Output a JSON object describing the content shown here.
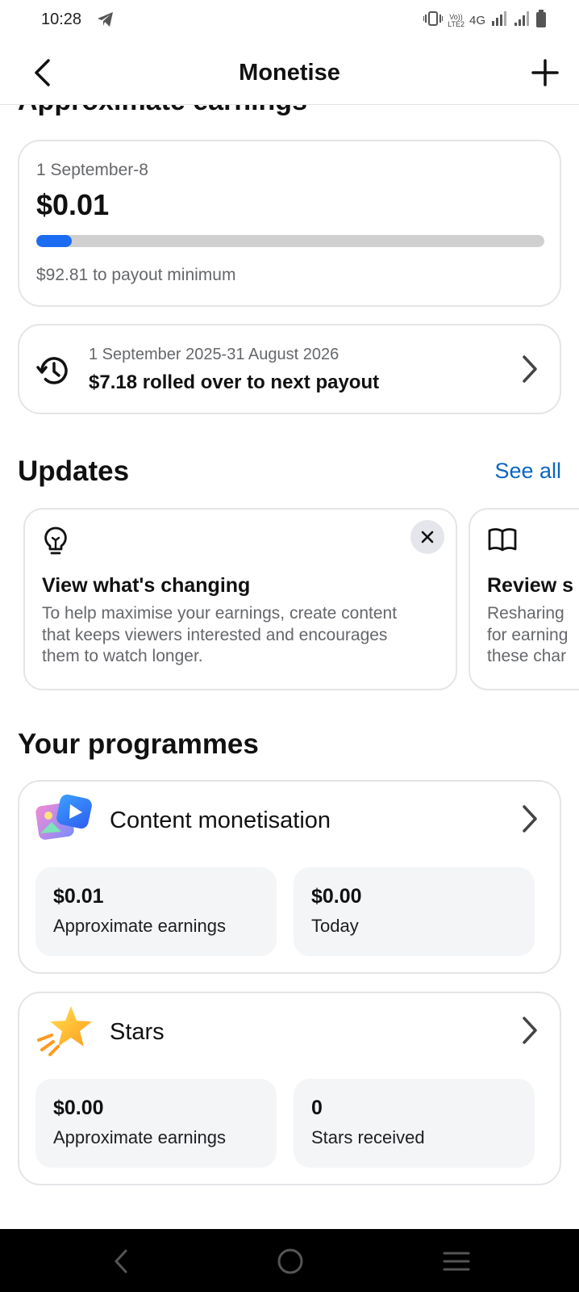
{
  "status_bar": {
    "time": "10:28",
    "volte_label_top": "Vo))",
    "volte_label_bottom": "LTE2",
    "network": "4G"
  },
  "header": {
    "title": "Monetise"
  },
  "earnings": {
    "section_heading": "Approximate earnings",
    "period": "1 September-8",
    "amount": "$0.01",
    "progress_fraction": 0.07,
    "payout_min_text": "$92.81 to payout minimum"
  },
  "rollover": {
    "dates": "1 September 2025-31 August 2026",
    "text": "$7.18 rolled over to next payout"
  },
  "updates": {
    "title": "Updates",
    "see_all": "See all",
    "cards": [
      {
        "title": "View what's changing",
        "body": "To help maximise your earnings, create content\nthat keeps viewers interested and encourages\nthem to watch longer."
      },
      {
        "title": "Review s",
        "body": "Resharing\nfor earning\nthese char"
      }
    ]
  },
  "programmes": {
    "title": "Your programmes",
    "items": [
      {
        "name": "Content monetisation",
        "stats": [
          {
            "value": "$0.01",
            "label": "Approximate earnings"
          },
          {
            "value": "$0.00",
            "label": "Today"
          }
        ]
      },
      {
        "name": "Stars",
        "stats": [
          {
            "value": "$0.00",
            "label": "Approximate earnings"
          },
          {
            "value": "0",
            "label": "Stars received"
          }
        ]
      }
    ]
  },
  "colors": {
    "accent_blue": "#1b6cf2",
    "link_blue": "#0a66c2",
    "secondary_text": "#65676b",
    "card_border": "#e4e5e8"
  }
}
